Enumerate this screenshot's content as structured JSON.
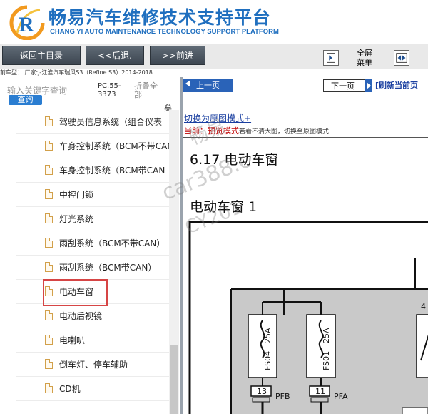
{
  "header": {
    "brand_cn": "畅易汽车维修技术支持平台",
    "brand_en": "CHANG YI AUTO MAINTENANCE TECHNOLOGY SUPPORT PLATFORM",
    "logo_letter": "R",
    "brand_color": "#1f6fbf"
  },
  "toolbar": {
    "home_label": "返回主目录",
    "back_label": "<<后退.",
    "forward_label": ">>前进",
    "fullscreen_line1": "全屏",
    "fullscreen_line2": "菜单"
  },
  "vehicle_line": "前车型：  厂家:J-江淮汽车瑞风S3（Refine S3）2014-2018",
  "left_pane": {
    "search_placeholder": "输入关键字查询",
    "search_button": "查询",
    "pc_number": "PC.55-3373",
    "collapse_all": "折叠全部",
    "cut_char": "矣",
    "items": [
      {
        "label": "驾驶员信息系统（组合仪表"
      },
      {
        "label": "车身控制系统（BCM不带CAN"
      },
      {
        "label": "车身控制系统（BCM带CAN"
      },
      {
        "label": "中控门锁"
      },
      {
        "label": "灯光系统"
      },
      {
        "label": "雨刮系统（BCM不带CAN）"
      },
      {
        "label": "雨刮系统（BCM带CAN）"
      },
      {
        "label": "电动车窗",
        "selected": true
      },
      {
        "label": "电动后视镜"
      },
      {
        "label": "电喇叭"
      },
      {
        "label": "倒车灯、停车辅助"
      },
      {
        "label": "CD机"
      }
    ]
  },
  "right_pane": {
    "prev_page": "上一页",
    "next_page": "下一页",
    "refresh_page": "[刷新当前页",
    "switch_link": "切换为原图模式+",
    "mode_prefix": "当前：",
    "mode_label": "预览模式",
    "mode_hint": "若看不清大图，切换至原图模式",
    "section_title": "6.17 电动车窗",
    "diagram_title": "电动车窗 1",
    "fuses": [
      {
        "id": "FS04",
        "rating": "25A",
        "connector": "13",
        "pin": "PFB"
      },
      {
        "id": "FS01",
        "rating": "25A",
        "connector": "11",
        "pin": "PFA"
      }
    ],
    "partial_fuse_label": "4"
  },
  "watermark": {
    "line1": "畅易",
    "line2": "car388.c",
    "line3": "CY201"
  },
  "colors": {
    "toolbar_button": "#4b5560",
    "link_blue": "#1a3fa0",
    "nav_blue": "#2a63b8",
    "mode_red": "#c00000",
    "selection_red": "#d64545"
  }
}
